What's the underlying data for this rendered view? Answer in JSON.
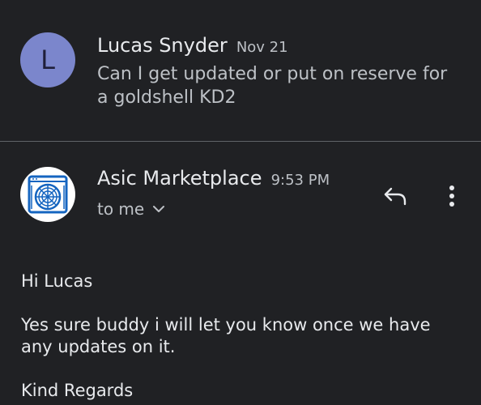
{
  "thread": {
    "previous_message": {
      "avatar_letter": "L",
      "sender": "Lucas Snyder",
      "date": "Nov 21",
      "snippet": "Can I get updated or put on reserve for a goldshell KD2"
    },
    "open_message": {
      "sender": "Asic Marketplace",
      "time": "9:53 PM",
      "recipient_label": "to me",
      "body": {
        "greeting": "Hi Lucas",
        "paragraph": "Yes sure buddy i will let you know once we have any updates on it.",
        "signoff": "Kind Regards"
      }
    }
  },
  "icons": {
    "logo": "asic-miner-logo-icon",
    "recipient_toggle": "chevron-down-icon",
    "reply": "reply-icon",
    "more": "more-vert-icon"
  },
  "colors": {
    "background": "#202124",
    "primary_text": "#e8eaed",
    "secondary_text": "#bdc1c6",
    "avatar_bg": "#7b86cc",
    "logo_blue": "#1565c0",
    "divider": "#5f6368"
  }
}
